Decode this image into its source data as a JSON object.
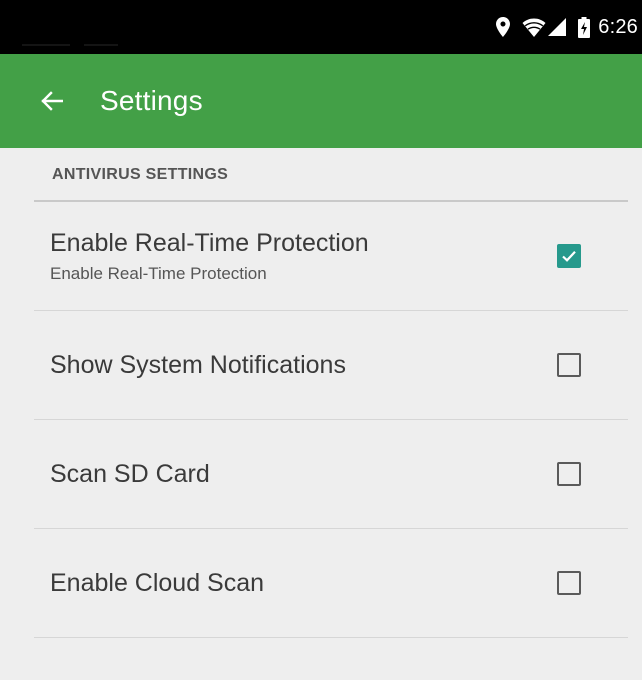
{
  "status_bar": {
    "time": "6:26",
    "icons": [
      "location-icon",
      "wifi-icon",
      "signal-icon",
      "battery-charging-icon"
    ]
  },
  "app_bar": {
    "title": "Settings",
    "back_icon": "arrow-left-icon",
    "color": "#43a047"
  },
  "section": {
    "header": "ANTIVIRUS SETTINGS"
  },
  "settings": [
    {
      "title": "Enable Real-Time Protection",
      "summary": "Enable Real-Time Protection",
      "checked": true
    },
    {
      "title": "Show System Notifications",
      "summary": "",
      "checked": false
    },
    {
      "title": "Scan SD Card",
      "summary": "",
      "checked": false
    },
    {
      "title": "Enable Cloud Scan",
      "summary": "",
      "checked": false
    }
  ],
  "colors": {
    "accent": "#26998c",
    "background": "#eeeeee"
  }
}
